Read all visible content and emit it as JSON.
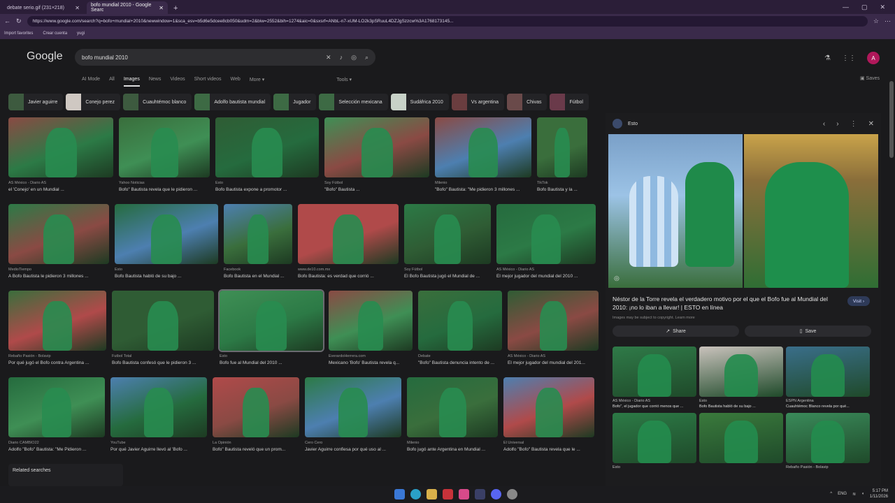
{
  "tabs": [
    {
      "label": "debate serio.gif (231×218)",
      "active": false
    },
    {
      "label": "bofo mundial 2010 - Google Searc",
      "active": true
    }
  ],
  "address": {
    "url": "https://www.google.com/search?q=bofo+mundial+2010&newwindow=1&sca_esv=b5d6e5dcee8cb050&udm=2&biw=2552&bih=1274&aic=0&sxsrf=ANbL-n7-xUM-LO2k3pSRuuL4DZJgSzzcw%3A1768173145... "
  },
  "bookmarks": [
    "Import favorites",
    "Crear cuenta",
    "yugi"
  ],
  "google": {
    "logo": "Google",
    "query": "bofo mundial 2010",
    "nav": [
      {
        "label": "AI Mode",
        "active": false
      },
      {
        "label": "All",
        "active": false
      },
      {
        "label": "Images",
        "active": true
      },
      {
        "label": "News",
        "active": false
      },
      {
        "label": "Videos",
        "active": false
      },
      {
        "label": "Short videos",
        "active": false
      },
      {
        "label": "Web",
        "active": false
      },
      {
        "label": "More ▾",
        "active": false
      }
    ],
    "tools": "Tools ▾",
    "saves": "Saves",
    "avatar": "A",
    "chips": [
      "Javier aguirre",
      "Conejo perez",
      "Cuauhtémoc blanco",
      "Adolfo bautista mundial",
      "Jugador",
      "Selección mexicana",
      "Sudáfrica 2010",
      "Vs argentina",
      "Chivas",
      "Fútbol"
    ]
  },
  "results": [
    [
      {
        "src": "AS México - Diario AS",
        "title": "el 'Conejo' en un Mundial ..."
      },
      {
        "src": "Yahoo Noticias",
        "title": "Bofo\" Bautista revela que le pidieron ..."
      },
      {
        "src": "Esto",
        "title": "Bofo Bautista expone a promotor ..."
      },
      {
        "src": "Soy Fútbol",
        "title": "\"Bofo\" Bautista ..."
      },
      {
        "src": "Milenio",
        "title": "\"Bofo\" Bautista: \"Me pidieron 3 millones ..."
      },
      {
        "src": "TikTok",
        "title": "Bofo Bautista y la ..."
      }
    ],
    [
      {
        "src": "MedioTiempo",
        "title": "A Bofo Bautista le pidieron 3 millones ..."
      },
      {
        "src": "Esto",
        "title": "Bofo Bautista habló de su bajo ..."
      },
      {
        "src": "Facebook",
        "title": "Bofo Bautista en el Mundial ..."
      },
      {
        "src": "www.de10.com.mx",
        "title": "Bofo Bautista: es verdad que corrió ..."
      },
      {
        "src": "Soy Fútbol",
        "title": "El Bofo Bautista jugó el Mundial de ..."
      },
      {
        "src": "AS México - Diario AS",
        "title": "El mejor jugador del mundial del 2010 ..."
      }
    ],
    [
      {
        "src": "Rebaño Pasión - Bolavip",
        "title": "Por qué jugó el Bofo contra Argentina ..."
      },
      {
        "src": "Futbol Total",
        "title": "Bofo Bautista confesó que le pidieron 3 ..."
      },
      {
        "src": "Esto",
        "title": "Bofo fue al Mundial del 2010 ..."
      },
      {
        "src": "EverardoHerrera.com",
        "title": "Mexicano 'Bofo' Bautista revela q..."
      },
      {
        "src": "Debate",
        "title": "\"Bofo\" Bautista denuncia intento de ..."
      },
      {
        "src": "AS México - Diario AS",
        "title": "El mejor jugador del mundial del 201..."
      }
    ],
    [
      {
        "src": "Diario CAMBIO22",
        "title": "Adolfo \"Bofo\" Bautista: \"Me Pidieron ..."
      },
      {
        "src": "YouTube",
        "title": "Por qué Javier Aguirre llevó al 'Bofo ..."
      },
      {
        "src": "La Opinión",
        "title": "Bofo\" Bautista reveló que un prom..."
      },
      {
        "src": "Cero Cero",
        "title": "Javier Aguirre confiesa por qué uso al ..."
      },
      {
        "src": "Milenio",
        "title": "Bofo jugó ante Argentina en Mundial ..."
      },
      {
        "src": "El Universal",
        "title": "Adolfo \"Bofo\" Bautista revela que le ..."
      }
    ]
  ],
  "related": "Related searches",
  "panel": {
    "source": "Esto",
    "title": "Néstor de la Torre revela el verdadero motivo por el que el Bofo fue al Mundial del 2010: ¡no lo iban a llevar! | ESTO en línea",
    "visit": "Visit ›",
    "note": "Images may be subject to copyright. Learn more",
    "share": "Share",
    "save": "Save",
    "related": [
      {
        "src": "AS México - Diario AS",
        "title": "Bofo\", el jugador que corrió menos que ..."
      },
      {
        "src": "Esto",
        "title": "Bofo Bautista habló de su bajo ..."
      },
      {
        "src": "ESPN Argentina",
        "title": "Cuauhtémoc Blanco revela por qué..."
      },
      {
        "src": "Esto",
        "title": ""
      },
      {
        "src": "",
        "title": ""
      },
      {
        "src": "Rebaño Pasión - Bolavip",
        "title": ""
      }
    ]
  },
  "taskbar": {
    "lang": "ENG",
    "time": "5:17 PM",
    "date": "1/11/2026"
  }
}
